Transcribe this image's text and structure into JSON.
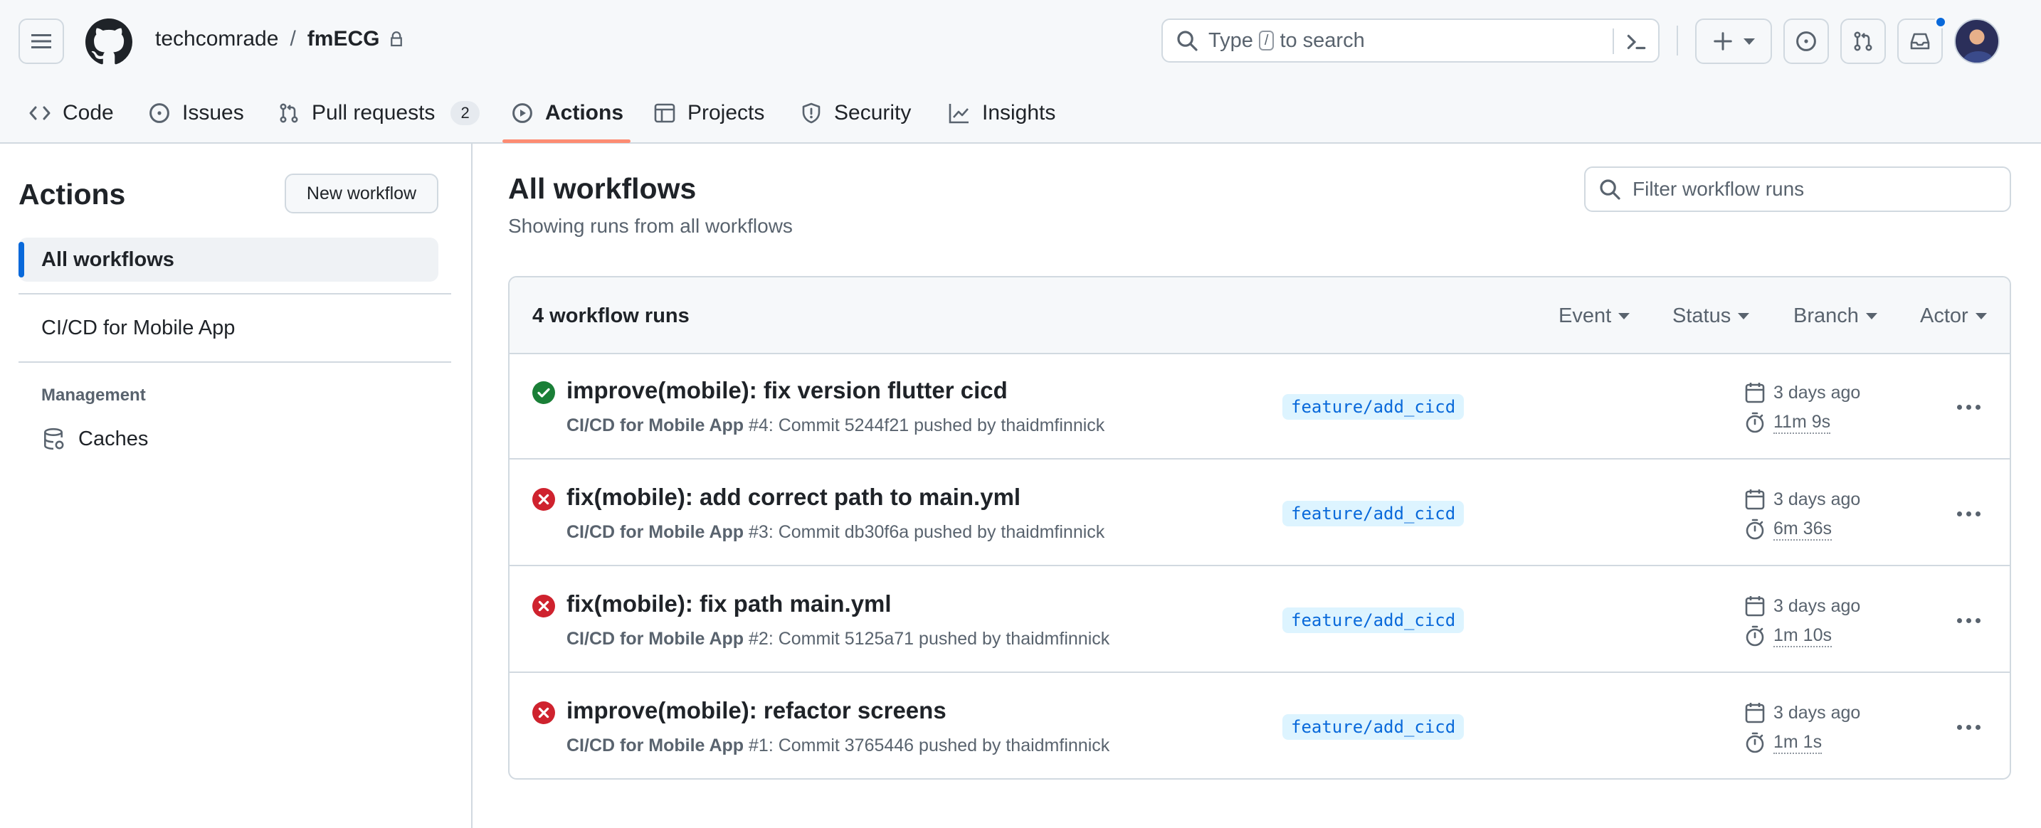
{
  "header": {
    "owner": "techcomrade",
    "separator": "/",
    "repo": "fmECG",
    "search": {
      "prefix": "Type",
      "key": "/",
      "suffix": "to search"
    }
  },
  "tabs": [
    {
      "label": "Code",
      "icon": "code-icon"
    },
    {
      "label": "Issues",
      "icon": "issue-icon"
    },
    {
      "label": "Pull requests",
      "icon": "pull-request-icon",
      "counter": "2"
    },
    {
      "label": "Actions",
      "icon": "play-icon",
      "active": true
    },
    {
      "label": "Projects",
      "icon": "table-icon"
    },
    {
      "label": "Security",
      "icon": "shield-icon"
    },
    {
      "label": "Insights",
      "icon": "graph-icon"
    }
  ],
  "sidebar": {
    "title": "Actions",
    "new_workflow": "New workflow",
    "items": [
      {
        "label": "All workflows",
        "active": true
      },
      {
        "label": "CI/CD for Mobile App"
      }
    ],
    "group_label": "Management",
    "caches_label": "Caches"
  },
  "main": {
    "title": "All workflows",
    "subtitle": "Showing runs from all workflows",
    "filter_placeholder": "Filter workflow runs",
    "runs_count": "4 workflow runs",
    "filters": [
      "Event",
      "Status",
      "Branch",
      "Actor"
    ],
    "runs": [
      {
        "status": "success",
        "title": "improve(mobile): fix version flutter cicd",
        "workflow": "CI/CD for Mobile App",
        "detail": " #4: Commit 5244f21 pushed by thaidmfinnick",
        "branch": "feature/add_cicd",
        "when": "3 days ago",
        "duration": "11m 9s"
      },
      {
        "status": "failure",
        "title": "fix(mobile): add correct path to main.yml",
        "workflow": "CI/CD for Mobile App",
        "detail": " #3: Commit db30f6a pushed by thaidmfinnick",
        "branch": "feature/add_cicd",
        "when": "3 days ago",
        "duration": "6m 36s"
      },
      {
        "status": "failure",
        "title": "fix(mobile): fix path main.yml",
        "workflow": "CI/CD for Mobile App",
        "detail": " #2: Commit 5125a71 pushed by thaidmfinnick",
        "branch": "feature/add_cicd",
        "when": "3 days ago",
        "duration": "1m 10s"
      },
      {
        "status": "failure",
        "title": "improve(mobile): refactor screens",
        "workflow": "CI/CD for Mobile App",
        "detail": " #1: Commit 3765446 pushed by thaidmfinnick",
        "branch": "feature/add_cicd",
        "when": "3 days ago",
        "duration": "1m 1s"
      }
    ]
  },
  "colors": {
    "accent": "#0969da",
    "success": "#1a7f37",
    "failure": "#cf222e",
    "tab_underline": "#fd8c73"
  }
}
